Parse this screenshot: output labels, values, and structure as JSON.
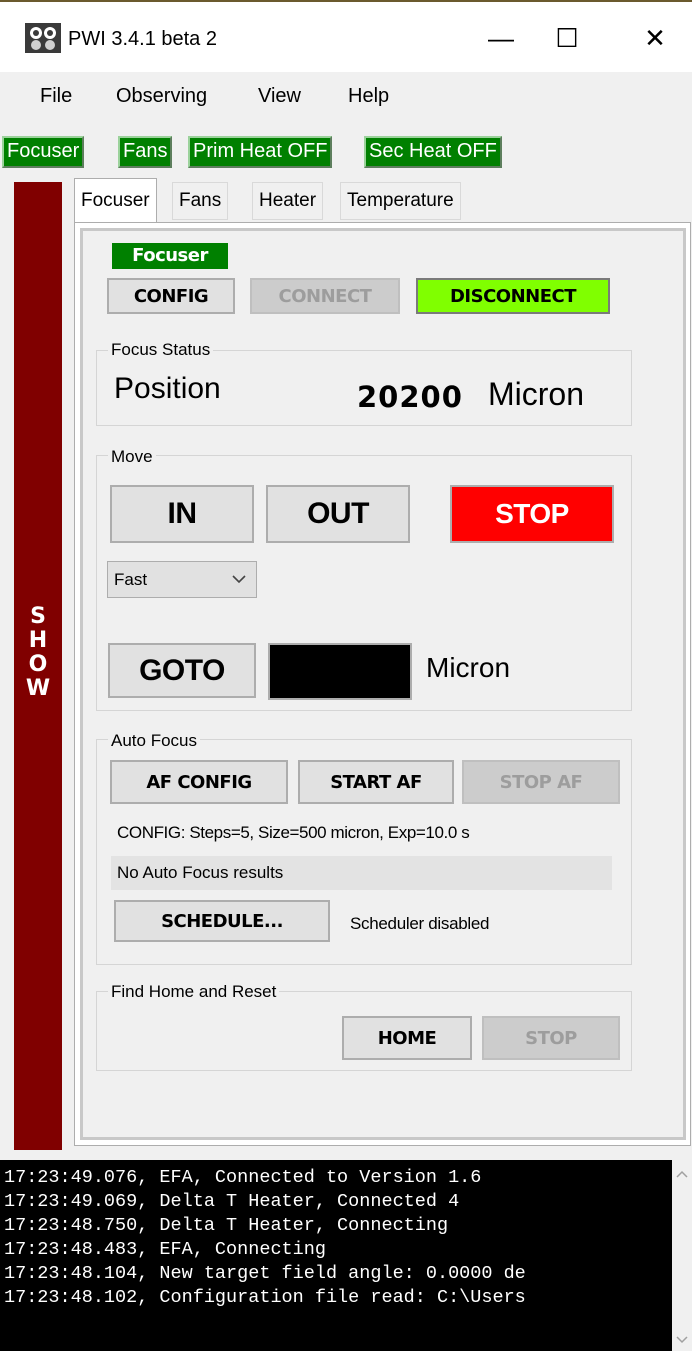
{
  "window": {
    "title": "PWI 3.4.1 beta 2",
    "minimize_glyph": "—",
    "maximize_glyph": "☐",
    "close_glyph": "✕"
  },
  "menu": [
    "File",
    "Observing",
    "View",
    "Help"
  ],
  "toggles": [
    "Focuser",
    "Fans",
    "Prim Heat OFF",
    "Sec Heat OFF"
  ],
  "show_label": [
    "S",
    "H",
    "O",
    "W"
  ],
  "tabs": [
    "Focuser",
    "Fans",
    "Heater",
    "Temperature"
  ],
  "focuser": {
    "badge": "Focuser",
    "config": "CONFIG",
    "connect": "CONNECT",
    "disconnect": "DISCONNECT"
  },
  "focus_status": {
    "group_label": "Focus Status",
    "position_label": "Position",
    "position_value": "20200",
    "unit": "Micron"
  },
  "move": {
    "group_label": "Move",
    "in": "IN",
    "out": "OUT",
    "stop": "STOP",
    "speed_selected": "Fast",
    "goto": "GOTO",
    "goto_value": "",
    "unit": "Micron"
  },
  "auto_focus": {
    "group_label": "Auto Focus",
    "af_config": "AF CONFIG",
    "start_af": "START AF",
    "stop_af": "STOP AF",
    "config_text": "CONFIG: Steps=5, Size=500 micron, Exp=10.0 s",
    "results_text": "No Auto Focus results",
    "schedule": "SCHEDULE...",
    "scheduler_status": "Scheduler disabled"
  },
  "home": {
    "group_label": "Find Home and Reset",
    "home": "HOME",
    "stop": "STOP"
  },
  "log": [
    "17:23:49.076, EFA, Connected to Version 1.6",
    "17:23:49.069, Delta T Heater, Connected 4",
    "17:23:48.750, Delta T Heater, Connecting",
    "17:23:48.483, EFA, Connecting",
    "17:23:48.104, New target field angle: 0.0000 de",
    "17:23:48.102, Configuration file read: C:\\Users"
  ],
  "colors": {
    "toggle_green": "#008000",
    "show_strip": "#800000",
    "stop_red": "#ff0000",
    "disconnect_green": "#80ff00"
  }
}
